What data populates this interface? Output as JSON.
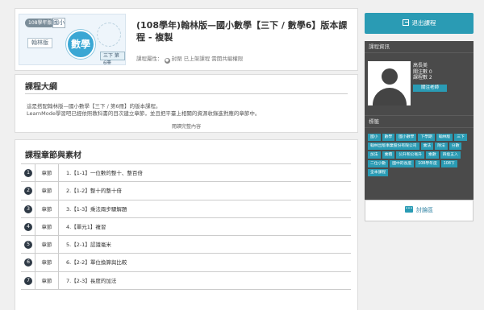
{
  "cover": {
    "grade_pill": "108學年版",
    "grade_tag": "國小",
    "publisher": "翰林版",
    "subject": "數學",
    "volume": "三下 第6冊"
  },
  "course": {
    "title": "(108學年)翰林版—國小數學【三下 / 數學6】版本課程 - 複製",
    "attrs_label": "課程屬性：",
    "attrs_value": "封閉 已上架課程 需開共編權限"
  },
  "outline": {
    "title": "課程大綱",
    "line1": "這是搭配翰林版—國小數學【三下 / 第6冊】的版本課程。",
    "line2": "LearnMode學習吧已經依照教科書的目次建立章節，並且把平臺上相關的資源收錄進對應的章節中。",
    "read_more": "閱讀完整內容"
  },
  "chapters": {
    "title": "課程章節與素材",
    "type_label": "章節",
    "items": [
      "1.【1-1】一位數的整十、整百倍",
      "2.【1-2】整十的整十倍",
      "3.【1-3】乘法兩步驟解題",
      "4.【單元1】複習",
      "5.【2-1】認識毫米",
      "6.【2-2】單位換算與比較",
      "7.【2-3】長度的加法"
    ]
  },
  "sidebar": {
    "exit_label": "退出課程",
    "info_title": "課程資訊",
    "teacher_name": "高長美",
    "followers": "關注數 0",
    "courses": "課程數 2",
    "follow_label": "關注老師",
    "tags_title": "標籤",
    "tags": [
      "國小",
      "數學",
      "國小數學",
      "下學期",
      "翰林版",
      "三下",
      "翰林出版事業股份有限公司",
      "乘法",
      "除法",
      "分數",
      "加法",
      "乘積",
      "公升和公毫升",
      "乘數",
      "四捨五入",
      "二位小數",
      "國中的長度",
      "108學年度",
      "108下",
      "全本課程"
    ],
    "discuss_label": "討論區"
  }
}
